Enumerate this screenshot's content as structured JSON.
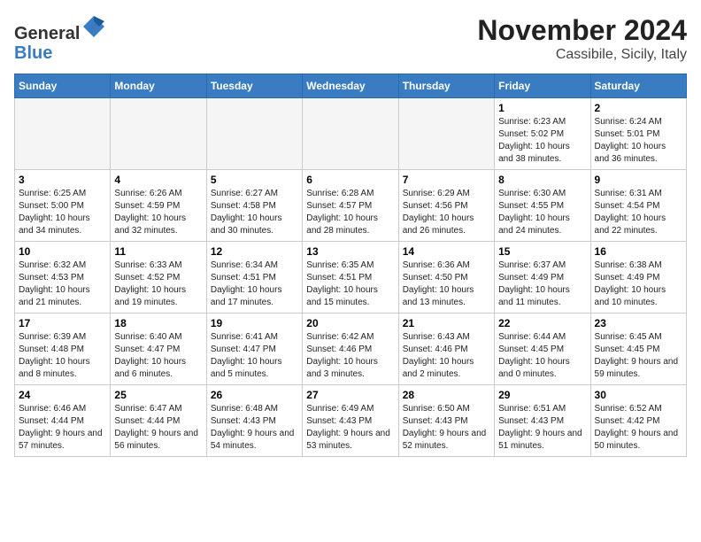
{
  "header": {
    "logo_general": "General",
    "logo_blue": "Blue",
    "month_title": "November 2024",
    "location": "Cassibile, Sicily, Italy"
  },
  "weekdays": [
    "Sunday",
    "Monday",
    "Tuesday",
    "Wednesday",
    "Thursday",
    "Friday",
    "Saturday"
  ],
  "weeks": [
    [
      {
        "day": "",
        "info": ""
      },
      {
        "day": "",
        "info": ""
      },
      {
        "day": "",
        "info": ""
      },
      {
        "day": "",
        "info": ""
      },
      {
        "day": "",
        "info": ""
      },
      {
        "day": "1",
        "info": "Sunrise: 6:23 AM\nSunset: 5:02 PM\nDaylight: 10 hours and 38 minutes."
      },
      {
        "day": "2",
        "info": "Sunrise: 6:24 AM\nSunset: 5:01 PM\nDaylight: 10 hours and 36 minutes."
      }
    ],
    [
      {
        "day": "3",
        "info": "Sunrise: 6:25 AM\nSunset: 5:00 PM\nDaylight: 10 hours and 34 minutes."
      },
      {
        "day": "4",
        "info": "Sunrise: 6:26 AM\nSunset: 4:59 PM\nDaylight: 10 hours and 32 minutes."
      },
      {
        "day": "5",
        "info": "Sunrise: 6:27 AM\nSunset: 4:58 PM\nDaylight: 10 hours and 30 minutes."
      },
      {
        "day": "6",
        "info": "Sunrise: 6:28 AM\nSunset: 4:57 PM\nDaylight: 10 hours and 28 minutes."
      },
      {
        "day": "7",
        "info": "Sunrise: 6:29 AM\nSunset: 4:56 PM\nDaylight: 10 hours and 26 minutes."
      },
      {
        "day": "8",
        "info": "Sunrise: 6:30 AM\nSunset: 4:55 PM\nDaylight: 10 hours and 24 minutes."
      },
      {
        "day": "9",
        "info": "Sunrise: 6:31 AM\nSunset: 4:54 PM\nDaylight: 10 hours and 22 minutes."
      }
    ],
    [
      {
        "day": "10",
        "info": "Sunrise: 6:32 AM\nSunset: 4:53 PM\nDaylight: 10 hours and 21 minutes."
      },
      {
        "day": "11",
        "info": "Sunrise: 6:33 AM\nSunset: 4:52 PM\nDaylight: 10 hours and 19 minutes."
      },
      {
        "day": "12",
        "info": "Sunrise: 6:34 AM\nSunset: 4:51 PM\nDaylight: 10 hours and 17 minutes."
      },
      {
        "day": "13",
        "info": "Sunrise: 6:35 AM\nSunset: 4:51 PM\nDaylight: 10 hours and 15 minutes."
      },
      {
        "day": "14",
        "info": "Sunrise: 6:36 AM\nSunset: 4:50 PM\nDaylight: 10 hours and 13 minutes."
      },
      {
        "day": "15",
        "info": "Sunrise: 6:37 AM\nSunset: 4:49 PM\nDaylight: 10 hours and 11 minutes."
      },
      {
        "day": "16",
        "info": "Sunrise: 6:38 AM\nSunset: 4:49 PM\nDaylight: 10 hours and 10 minutes."
      }
    ],
    [
      {
        "day": "17",
        "info": "Sunrise: 6:39 AM\nSunset: 4:48 PM\nDaylight: 10 hours and 8 minutes."
      },
      {
        "day": "18",
        "info": "Sunrise: 6:40 AM\nSunset: 4:47 PM\nDaylight: 10 hours and 6 minutes."
      },
      {
        "day": "19",
        "info": "Sunrise: 6:41 AM\nSunset: 4:47 PM\nDaylight: 10 hours and 5 minutes."
      },
      {
        "day": "20",
        "info": "Sunrise: 6:42 AM\nSunset: 4:46 PM\nDaylight: 10 hours and 3 minutes."
      },
      {
        "day": "21",
        "info": "Sunrise: 6:43 AM\nSunset: 4:46 PM\nDaylight: 10 hours and 2 minutes."
      },
      {
        "day": "22",
        "info": "Sunrise: 6:44 AM\nSunset: 4:45 PM\nDaylight: 10 hours and 0 minutes."
      },
      {
        "day": "23",
        "info": "Sunrise: 6:45 AM\nSunset: 4:45 PM\nDaylight: 9 hours and 59 minutes."
      }
    ],
    [
      {
        "day": "24",
        "info": "Sunrise: 6:46 AM\nSunset: 4:44 PM\nDaylight: 9 hours and 57 minutes."
      },
      {
        "day": "25",
        "info": "Sunrise: 6:47 AM\nSunset: 4:44 PM\nDaylight: 9 hours and 56 minutes."
      },
      {
        "day": "26",
        "info": "Sunrise: 6:48 AM\nSunset: 4:43 PM\nDaylight: 9 hours and 54 minutes."
      },
      {
        "day": "27",
        "info": "Sunrise: 6:49 AM\nSunset: 4:43 PM\nDaylight: 9 hours and 53 minutes."
      },
      {
        "day": "28",
        "info": "Sunrise: 6:50 AM\nSunset: 4:43 PM\nDaylight: 9 hours and 52 minutes."
      },
      {
        "day": "29",
        "info": "Sunrise: 6:51 AM\nSunset: 4:43 PM\nDaylight: 9 hours and 51 minutes."
      },
      {
        "day": "30",
        "info": "Sunrise: 6:52 AM\nSunset: 4:42 PM\nDaylight: 9 hours and 50 minutes."
      }
    ]
  ]
}
